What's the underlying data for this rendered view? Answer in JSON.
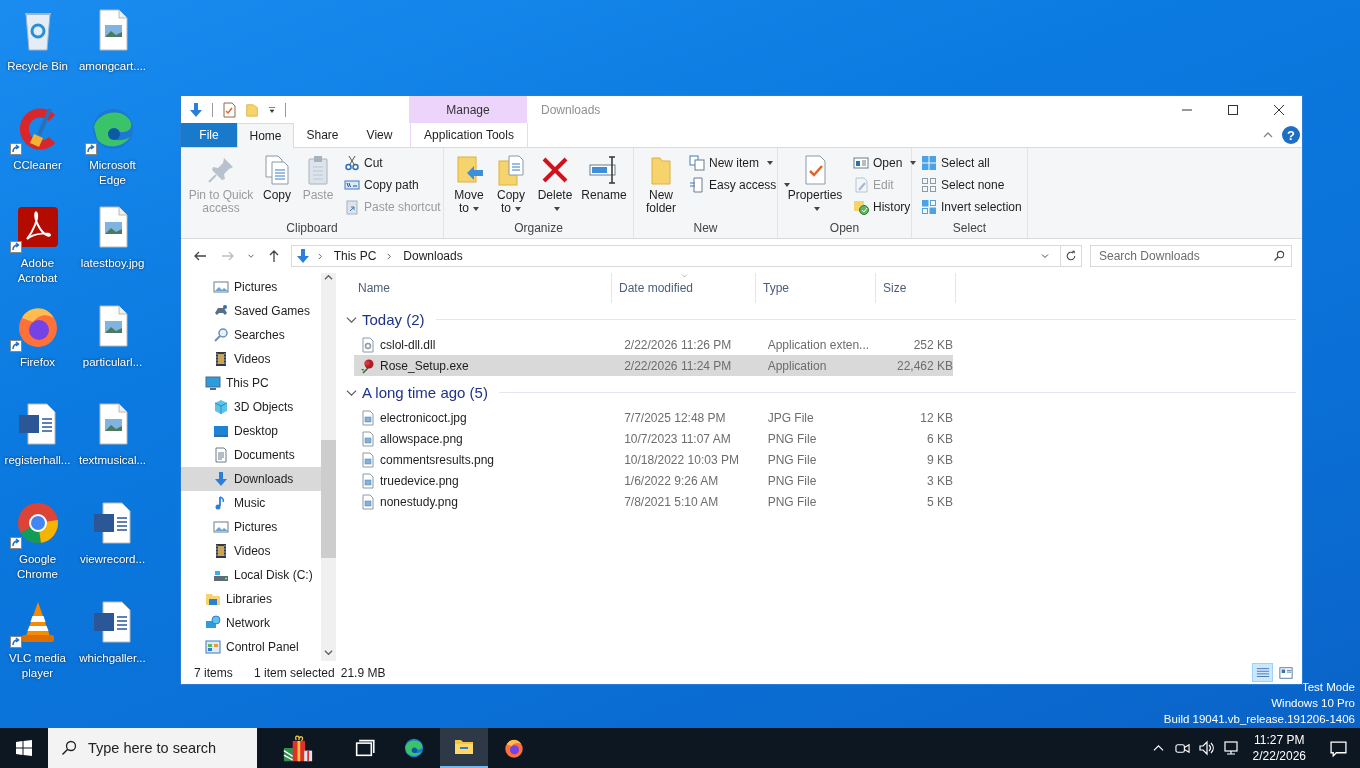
{
  "desktop_icons": [
    {
      "label": "Recycle Bin",
      "kind": "bin",
      "shortcut": false
    },
    {
      "label": "CCleaner",
      "kind": "cleaner",
      "shortcut": true
    },
    {
      "label": "Adobe Acrobat",
      "kind": "acrobat",
      "shortcut": true
    },
    {
      "label": "Firefox",
      "kind": "firefox",
      "shortcut": true
    },
    {
      "label": "registerhall...",
      "kind": "word",
      "shortcut": false
    },
    {
      "label": "Google Chrome",
      "kind": "chrome",
      "shortcut": true
    },
    {
      "label": "VLC media player",
      "kind": "vlc",
      "shortcut": true
    },
    {
      "label": "amongcart....",
      "kind": "image",
      "shortcut": false
    },
    {
      "label": "Microsoft Edge",
      "kind": "edge",
      "shortcut": true
    },
    {
      "label": "latestboy.jpg",
      "kind": "image",
      "shortcut": false
    },
    {
      "label": "particularl...",
      "kind": "image",
      "shortcut": false
    },
    {
      "label": "textmusical...",
      "kind": "image",
      "shortcut": false
    },
    {
      "label": "viewrecord...",
      "kind": "word",
      "shortcut": false
    },
    {
      "label": "whichgaller...",
      "kind": "word",
      "shortcut": false
    }
  ],
  "explorer": {
    "title": "Downloads",
    "context_group": "Manage",
    "help_symbol": "?",
    "tabs": [
      {
        "label": "File",
        "kind": "file",
        "selected": false
      },
      {
        "label": "Home",
        "kind": "normal",
        "selected": true
      },
      {
        "label": "Share",
        "kind": "normal",
        "selected": false
      },
      {
        "label": "View",
        "kind": "normal",
        "selected": false
      },
      {
        "label": "Application Tools",
        "kind": "context",
        "selected": false
      }
    ],
    "ribbon_groups": [
      {
        "label": "Clipboard",
        "buttons": [
          {
            "label": "Pin to Quick access",
            "kind": "large",
            "disabled": true,
            "dropdown": false
          },
          {
            "label": "Copy",
            "kind": "large",
            "disabled": false,
            "dropdown": false
          },
          {
            "label": "Paste",
            "kind": "large",
            "disabled": true,
            "dropdown": false
          },
          {
            "label": "Cut",
            "kind": "small",
            "disabled": false,
            "dropdown": false
          },
          {
            "label": "Copy path",
            "kind": "small",
            "disabled": false,
            "dropdown": false
          },
          {
            "label": "Paste shortcut",
            "kind": "small",
            "disabled": true,
            "dropdown": false
          }
        ]
      },
      {
        "label": "Organize",
        "buttons": [
          {
            "label": "Move to",
            "kind": "large",
            "disabled": false,
            "dropdown": true
          },
          {
            "label": "Copy to",
            "kind": "large",
            "disabled": false,
            "dropdown": true
          },
          {
            "label": "Delete",
            "kind": "large",
            "disabled": false,
            "dropdown": true
          },
          {
            "label": "Rename",
            "kind": "large",
            "disabled": false,
            "dropdown": false
          }
        ]
      },
      {
        "label": "New",
        "buttons": [
          {
            "label": "New folder",
            "kind": "large",
            "disabled": false,
            "dropdown": false
          },
          {
            "label": "New item",
            "kind": "small",
            "disabled": false,
            "dropdown": true
          },
          {
            "label": "Easy access",
            "kind": "small",
            "disabled": false,
            "dropdown": true
          }
        ]
      },
      {
        "label": "Open",
        "buttons": [
          {
            "label": "Properties",
            "kind": "large",
            "disabled": false,
            "dropdown": true
          },
          {
            "label": "Open",
            "kind": "small",
            "disabled": false,
            "dropdown": true
          },
          {
            "label": "Edit",
            "kind": "small",
            "disabled": true,
            "dropdown": false
          },
          {
            "label": "History",
            "kind": "small",
            "disabled": false,
            "dropdown": false
          }
        ]
      },
      {
        "label": "Select",
        "buttons": [
          {
            "label": "Select all",
            "kind": "small",
            "disabled": false,
            "dropdown": false
          },
          {
            "label": "Select none",
            "kind": "small",
            "disabled": false,
            "dropdown": false
          },
          {
            "label": "Invert selection",
            "kind": "small",
            "disabled": false,
            "dropdown": false
          }
        ]
      }
    ],
    "nav_buttons": [
      {
        "kind": "back",
        "disabled": false
      },
      {
        "kind": "forward",
        "disabled": true
      },
      {
        "kind": "recent",
        "disabled": false
      },
      {
        "kind": "up",
        "disabled": false
      }
    ],
    "address": {
      "path": [
        "This PC",
        "Downloads"
      ]
    },
    "search": {
      "placeholder": "Search Downloads"
    },
    "nav_pane": {
      "items": [
        {
          "children": [
            {
              "label": "Pictures",
              "kind": "pictures",
              "selected": false
            },
            {
              "label": "Saved Games",
              "kind": "games",
              "selected": false
            },
            {
              "label": "Searches",
              "kind": "searches",
              "selected": false
            },
            {
              "label": "Videos",
              "kind": "videos",
              "selected": false
            }
          ]
        },
        {
          "label": "This PC",
          "kind": "pc",
          "selected": false,
          "children": [
            {
              "label": "3D Objects",
              "kind": "objects",
              "selected": false
            },
            {
              "label": "Desktop",
              "kind": "desktop",
              "selected": false
            },
            {
              "label": "Documents",
              "kind": "documents",
              "selected": false
            },
            {
              "label": "Downloads",
              "kind": "downloads",
              "selected": true
            },
            {
              "label": "Music",
              "kind": "music",
              "selected": false
            },
            {
              "label": "Pictures",
              "kind": "pictures",
              "selected": false
            },
            {
              "label": "Videos",
              "kind": "videos",
              "selected": false
            },
            {
              "label": "Local Disk (C:)",
              "kind": "disk",
              "selected": false
            }
          ]
        },
        {
          "label": "Libraries",
          "kind": "libraries",
          "selected": false
        },
        {
          "label": "Network",
          "kind": "network",
          "selected": false
        },
        {
          "label": "Control Panel",
          "kind": "control",
          "selected": false
        }
      ]
    },
    "columns": [
      {
        "label": "Name",
        "sorted": false
      },
      {
        "label": "Date modified",
        "sorted": true
      },
      {
        "label": "Type",
        "sorted": false
      },
      {
        "label": "Size",
        "sorted": false
      }
    ],
    "groups": [
      {
        "label": "Today (2)",
        "expanded": true,
        "files": [
          {
            "name": "cslol-dll.dll",
            "date": "2/22/2026 11:26 PM",
            "type": "Application exten...",
            "size": "252 KB",
            "kind": "dll",
            "selected": false
          },
          {
            "name": "Rose_Setup.exe",
            "date": "2/22/2026 11:24 PM",
            "type": "Application",
            "size": "22,462 KB",
            "kind": "exe",
            "selected": true
          }
        ]
      },
      {
        "label": "A long time ago (5)",
        "expanded": true,
        "files": [
          {
            "name": "electronicoct.jpg",
            "date": "7/7/2025 12:48 PM",
            "type": "JPG File",
            "size": "12 KB",
            "kind": "image",
            "selected": false
          },
          {
            "name": "allowspace.png",
            "date": "10/7/2023 11:07 AM",
            "type": "PNG File",
            "size": "6 KB",
            "kind": "image",
            "selected": false
          },
          {
            "name": "commentsresults.png",
            "date": "10/18/2022 10:03 PM",
            "type": "PNG File",
            "size": "9 KB",
            "kind": "image",
            "selected": false
          },
          {
            "name": "truedevice.png",
            "date": "1/6/2022 9:26 AM",
            "type": "PNG File",
            "size": "3 KB",
            "kind": "image",
            "selected": false
          },
          {
            "name": "nonestudy.png",
            "date": "7/8/2021 5:10 AM",
            "type": "PNG File",
            "size": "5 KB",
            "kind": "image",
            "selected": false
          }
        ]
      }
    ],
    "status_bar": {
      "item_count": "7 items",
      "selection": "1 item selected",
      "selection_size": "21.9 MB"
    },
    "views": [
      {
        "kind": "details",
        "selected": true
      },
      {
        "kind": "tiles",
        "selected": false
      }
    ]
  },
  "system_info": [
    "Test Mode",
    "Windows 10 Pro",
    "Build 19041.vb_release.191206-1406"
  ],
  "taskbar": {
    "search_placeholder": "Type here to search",
    "apps": [
      {
        "kind": "taskview",
        "active": false
      },
      {
        "kind": "edge",
        "active": false
      },
      {
        "kind": "explorer",
        "active": true
      },
      {
        "kind": "firefox",
        "active": false
      }
    ],
    "clock": {
      "time": "11:27 PM",
      "date": "2/22/2026"
    }
  }
}
